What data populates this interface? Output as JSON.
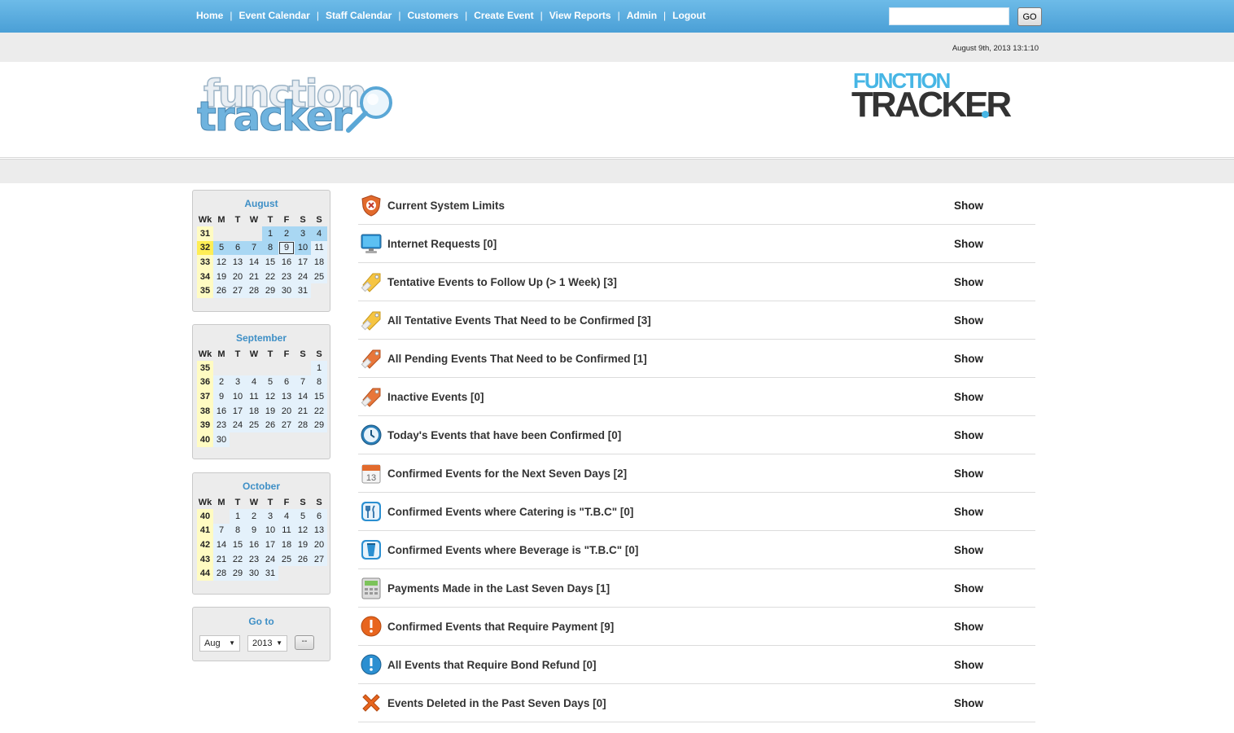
{
  "nav": {
    "items": [
      "Home",
      "Event Calendar",
      "Staff Calendar",
      "Customers",
      "Create Event",
      "View Reports",
      "Admin",
      "Logout"
    ],
    "separator": "|",
    "search_value": "",
    "go_label": "GO"
  },
  "datetime": "August 9th, 2013 13:1:10",
  "logos": {
    "left_line1": "function",
    "left_line2": "tracker",
    "right_line1": "FUNCTION",
    "right_line2": "TRACKER"
  },
  "calendar": {
    "weekday_headers": [
      "Wk",
      "M",
      "T",
      "W",
      "T",
      "F",
      "S",
      "S"
    ],
    "months": [
      {
        "name": "August",
        "weeks": [
          {
            "wk": "31",
            "days": [
              "",
              "",
              "",
              "1",
              "2",
              "3",
              "4"
            ]
          },
          {
            "wk": "32",
            "days": [
              "5",
              "6",
              "7",
              "8",
              "9",
              "10",
              "11"
            ]
          },
          {
            "wk": "33",
            "days": [
              "12",
              "13",
              "14",
              "15",
              "16",
              "17",
              "18"
            ]
          },
          {
            "wk": "34",
            "days": [
              "19",
              "20",
              "21",
              "22",
              "23",
              "24",
              "25"
            ]
          },
          {
            "wk": "35",
            "days": [
              "26",
              "27",
              "28",
              "29",
              "30",
              "31",
              ""
            ]
          }
        ]
      },
      {
        "name": "September",
        "weeks": [
          {
            "wk": "35",
            "days": [
              "",
              "",
              "",
              "",
              "",
              "",
              "1"
            ]
          },
          {
            "wk": "36",
            "days": [
              "2",
              "3",
              "4",
              "5",
              "6",
              "7",
              "8"
            ]
          },
          {
            "wk": "37",
            "days": [
              "9",
              "10",
              "11",
              "12",
              "13",
              "14",
              "15"
            ]
          },
          {
            "wk": "38",
            "days": [
              "16",
              "17",
              "18",
              "19",
              "20",
              "21",
              "22"
            ]
          },
          {
            "wk": "39",
            "days": [
              "23",
              "24",
              "25",
              "26",
              "27",
              "28",
              "29"
            ]
          },
          {
            "wk": "40",
            "days": [
              "30",
              "",
              "",
              "",
              "",
              "",
              ""
            ]
          }
        ]
      },
      {
        "name": "October",
        "weeks": [
          {
            "wk": "40",
            "days": [
              "",
              "1",
              "2",
              "3",
              "4",
              "5",
              "6"
            ]
          },
          {
            "wk": "41",
            "days": [
              "7",
              "8",
              "9",
              "10",
              "11",
              "12",
              "13"
            ]
          },
          {
            "wk": "42",
            "days": [
              "14",
              "15",
              "16",
              "17",
              "18",
              "19",
              "20"
            ]
          },
          {
            "wk": "43",
            "days": [
              "21",
              "22",
              "23",
              "24",
              "25",
              "26",
              "27"
            ]
          },
          {
            "wk": "44",
            "days": [
              "28",
              "29",
              "30",
              "31",
              "",
              "",
              ""
            ]
          }
        ]
      }
    ],
    "current_week": "32",
    "today": "9",
    "goto": {
      "title": "Go to",
      "month_value": "Aug",
      "year_value": "2013",
      "button_label": "--"
    }
  },
  "reports": {
    "show_label": "Show",
    "items": [
      {
        "label": "Current System Limits",
        "icon": "shield-icon"
      },
      {
        "label": "Internet Requests [0]",
        "icon": "monitor-icon"
      },
      {
        "label": "Tentative Events to Follow Up (> 1 Week) [3]",
        "icon": "tag-yellow-icon"
      },
      {
        "label": "All Tentative Events That Need to be Confirmed [3]",
        "icon": "tag-yellow-icon"
      },
      {
        "label": "All Pending Events That Need to be Confirmed [1]",
        "icon": "tag-orange-icon"
      },
      {
        "label": "Inactive Events [0]",
        "icon": "tag-orange-icon"
      },
      {
        "label": "Today's Events that have been Confirmed [0]",
        "icon": "clock-icon"
      },
      {
        "label": "Confirmed Events for the Next Seven Days [2]",
        "icon": "calendar-icon"
      },
      {
        "label": "Confirmed Events where Catering is \"T.B.C\" [0]",
        "icon": "cutlery-icon"
      },
      {
        "label": "Confirmed Events where Beverage is \"T.B.C\" [0]",
        "icon": "cup-icon"
      },
      {
        "label": "Payments Made in the Last Seven Days [1]",
        "icon": "calculator-icon"
      },
      {
        "label": "Confirmed Events that Require Payment [9]",
        "icon": "alert-orange-icon"
      },
      {
        "label": "All Events that Require Bond Refund [0]",
        "icon": "alert-blue-icon"
      },
      {
        "label": "Events Deleted in the Past Seven Days [0]",
        "icon": "delete-x-icon"
      }
    ]
  },
  "colors": {
    "nav_bar": "#4a9fd6",
    "accent_blue": "#3e8fc6",
    "week_highlight": "#fffbc2",
    "current_week": "#ffee55",
    "past_day": "#a9d7f3",
    "day_cell": "#e4f1fb"
  }
}
